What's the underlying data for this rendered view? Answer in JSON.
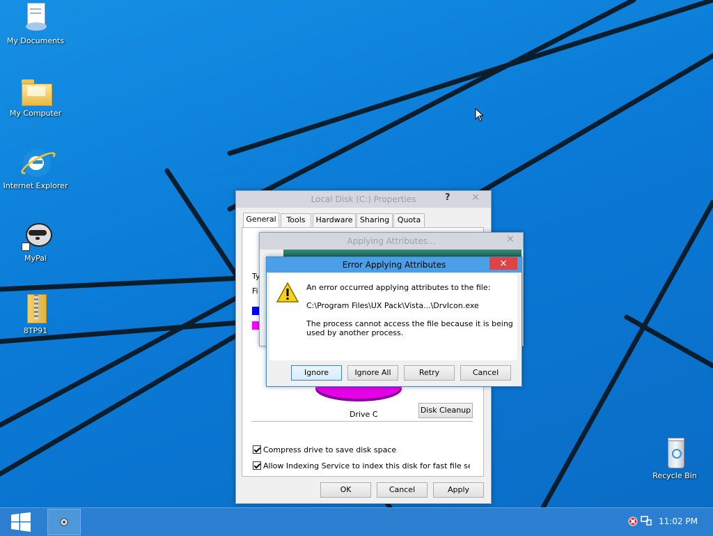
{
  "desktop": {
    "icons": [
      {
        "label": "My Documents"
      },
      {
        "label": "My Computer"
      },
      {
        "label": "Internet Explorer"
      },
      {
        "label": "MyPal"
      },
      {
        "label": "8TP91"
      },
      {
        "label": "Recycle Bin"
      }
    ]
  },
  "properties": {
    "title": "Local Disk (C:) Properties",
    "help_glyph": "?",
    "close_glyph": "×",
    "tabs": [
      "General",
      "Tools",
      "Hardware",
      "Sharing",
      "Quota"
    ],
    "partial_labels": [
      "Ty",
      "Fi"
    ],
    "drive_label": "Drive C",
    "disk_cleanup": "Disk Cleanup",
    "compress_label": "Compress drive to save disk space",
    "indexing_label": "Allow Indexing Service to index this disk for fast file searcl",
    "ok": "OK",
    "cancel": "Cancel",
    "apply": "Apply",
    "colors": {
      "used": "#0000ff",
      "free": "#ff00ff"
    }
  },
  "applying": {
    "title": "Applying Attributes...",
    "close_glyph": "×"
  },
  "error": {
    "title": "Error Applying Attributes",
    "close_glyph": "×",
    "line1": "An error occurred applying attributes to the file:",
    "path": "C:\\Program Files\\UX Pack\\Vista...\\DrvIcon.exe",
    "line3": "The process cannot access the file because it is being",
    "line4": "used by another process.",
    "buttons": {
      "ignore": "Ignore",
      "ignore_all": "Ignore All",
      "retry": "Retry",
      "cancel": "Cancel"
    }
  },
  "taskbar": {
    "clock": "11:02 PM"
  },
  "theme": {
    "accent": "#0a7ad6",
    "error_close": "#e04343",
    "title_active": "#4a9fe6"
  }
}
